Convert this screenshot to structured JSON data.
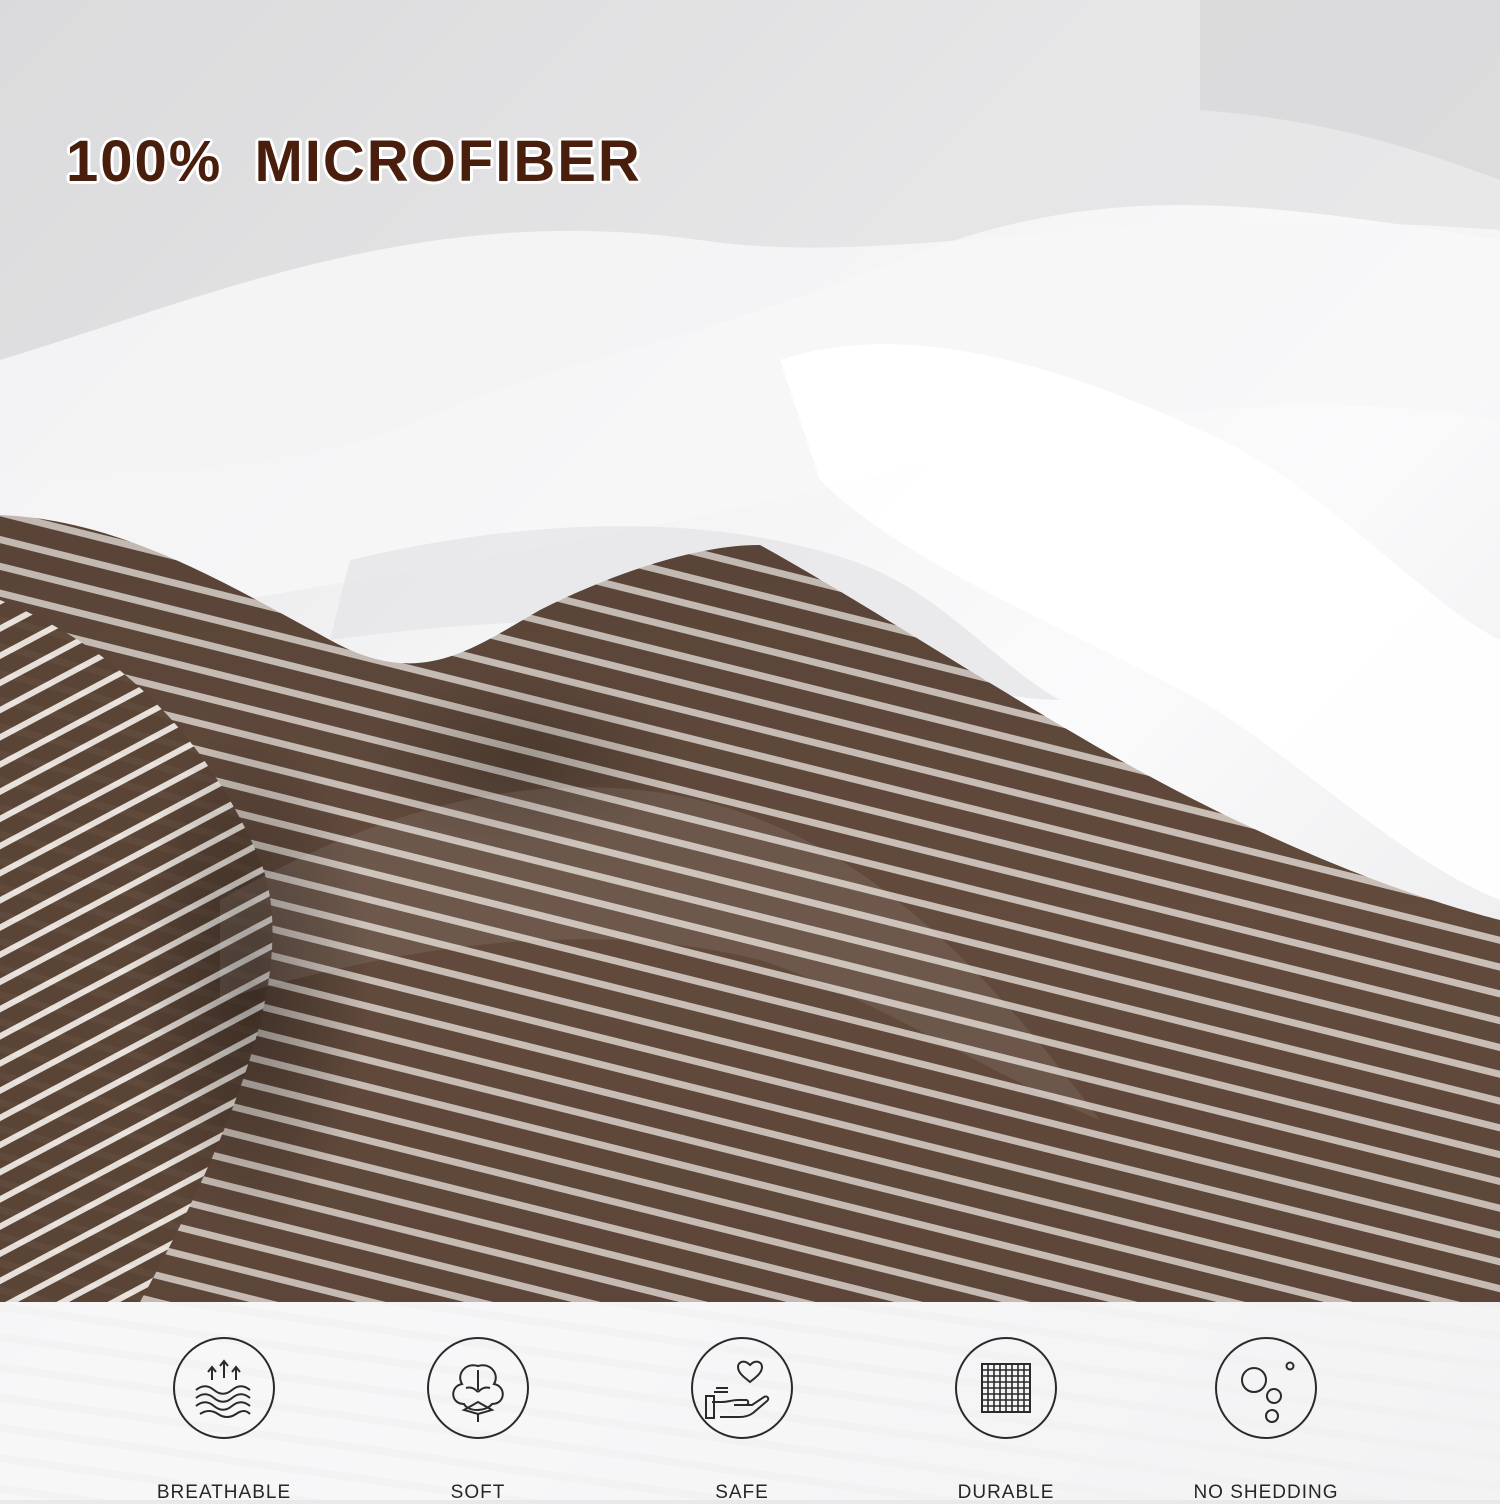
{
  "headline": "100%  MICROFIBER",
  "colors": {
    "headline": "#4a1e0c",
    "fabric_brown": "#6b5446",
    "fabric_white": "#f4f4f5",
    "icon_stroke": "#2a2a2a"
  },
  "features": [
    {
      "icon": "breathable-layers-icon",
      "label": "BREATHABLE"
    },
    {
      "icon": "cotton-boll-icon",
      "label": "SOFT"
    },
    {
      "icon": "heart-hand-icon",
      "label": "SAFE"
    },
    {
      "icon": "woven-grid-icon",
      "label": "DURABLE"
    },
    {
      "icon": "bubbles-icon",
      "label": "NO SHEDDING"
    }
  ]
}
